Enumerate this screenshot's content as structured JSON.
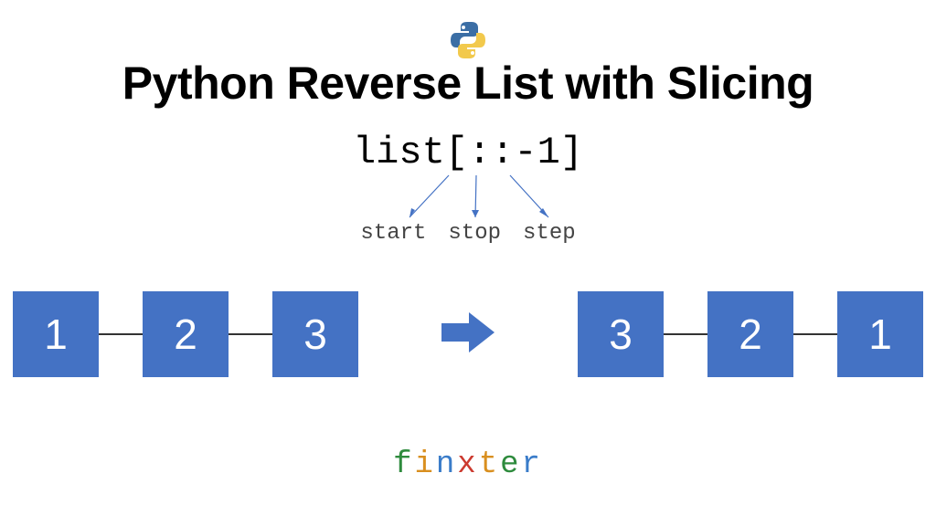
{
  "title": "Python Reverse List with Slicing",
  "code": "list[::-1]",
  "slice_parts": {
    "start": "start",
    "stop": "stop",
    "step": "step"
  },
  "list_before": [
    "1",
    "2",
    "3"
  ],
  "list_after": [
    "3",
    "2",
    "1"
  ],
  "brand_letters": [
    "f",
    "i",
    "n",
    "x",
    "t",
    "e",
    "r"
  ],
  "colors": {
    "node_bg": "#4472c4",
    "arrow": "#4472c4"
  }
}
